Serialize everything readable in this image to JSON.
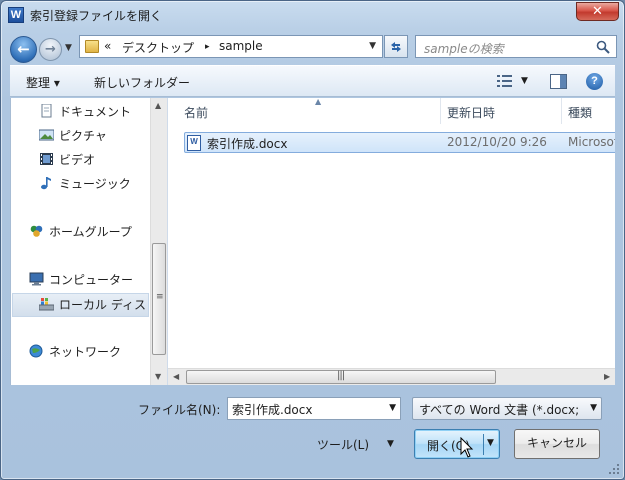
{
  "window": {
    "title": "索引登録ファイルを開く",
    "app_icon": "W",
    "close_glyph": "✕"
  },
  "nav": {
    "back_glyph": "←",
    "forward_glyph": "→",
    "address": {
      "overflow": "«",
      "crumbs": [
        "デスクトップ",
        "sample"
      ],
      "separator": "▸"
    },
    "search_placeholder": "sampleの検索"
  },
  "toolbar": {
    "organize": "整理 ▾",
    "new_folder": "新しいフォルダー",
    "help": "?"
  },
  "navpane": {
    "items": [
      {
        "label": "ドキュメント",
        "icon": "document-icon"
      },
      {
        "label": "ピクチャ",
        "icon": "picture-icon"
      },
      {
        "label": "ビデオ",
        "icon": "video-icon"
      },
      {
        "label": "ミュージック",
        "icon": "music-icon"
      },
      {
        "label": "ホームグループ",
        "icon": "homegroup-icon"
      },
      {
        "label": "コンピューター",
        "icon": "computer-icon"
      },
      {
        "label": "ローカル ディス",
        "icon": "local-disk-icon"
      },
      {
        "label": "ネットワーク",
        "icon": "network-icon"
      }
    ],
    "selected_index": 6
  },
  "filelist": {
    "columns": [
      "名前",
      "更新日時",
      "種類"
    ],
    "rows": [
      {
        "name": "索引作成.docx",
        "modified": "2012/10/20 9:26",
        "type": "Microsoft"
      }
    ]
  },
  "bottom": {
    "filename_label": "ファイル名(N):",
    "filename_value": "索引作成.docx",
    "filetype_value": "すべての Word 文書 (*.docx;",
    "tools_label": "ツール(L)",
    "open_label": "開く(O)",
    "cancel_label": "キャンセル"
  },
  "colors": {
    "accent": "#3c7fb1",
    "close": "#c23a2e",
    "selection": "#cfe4fa"
  }
}
